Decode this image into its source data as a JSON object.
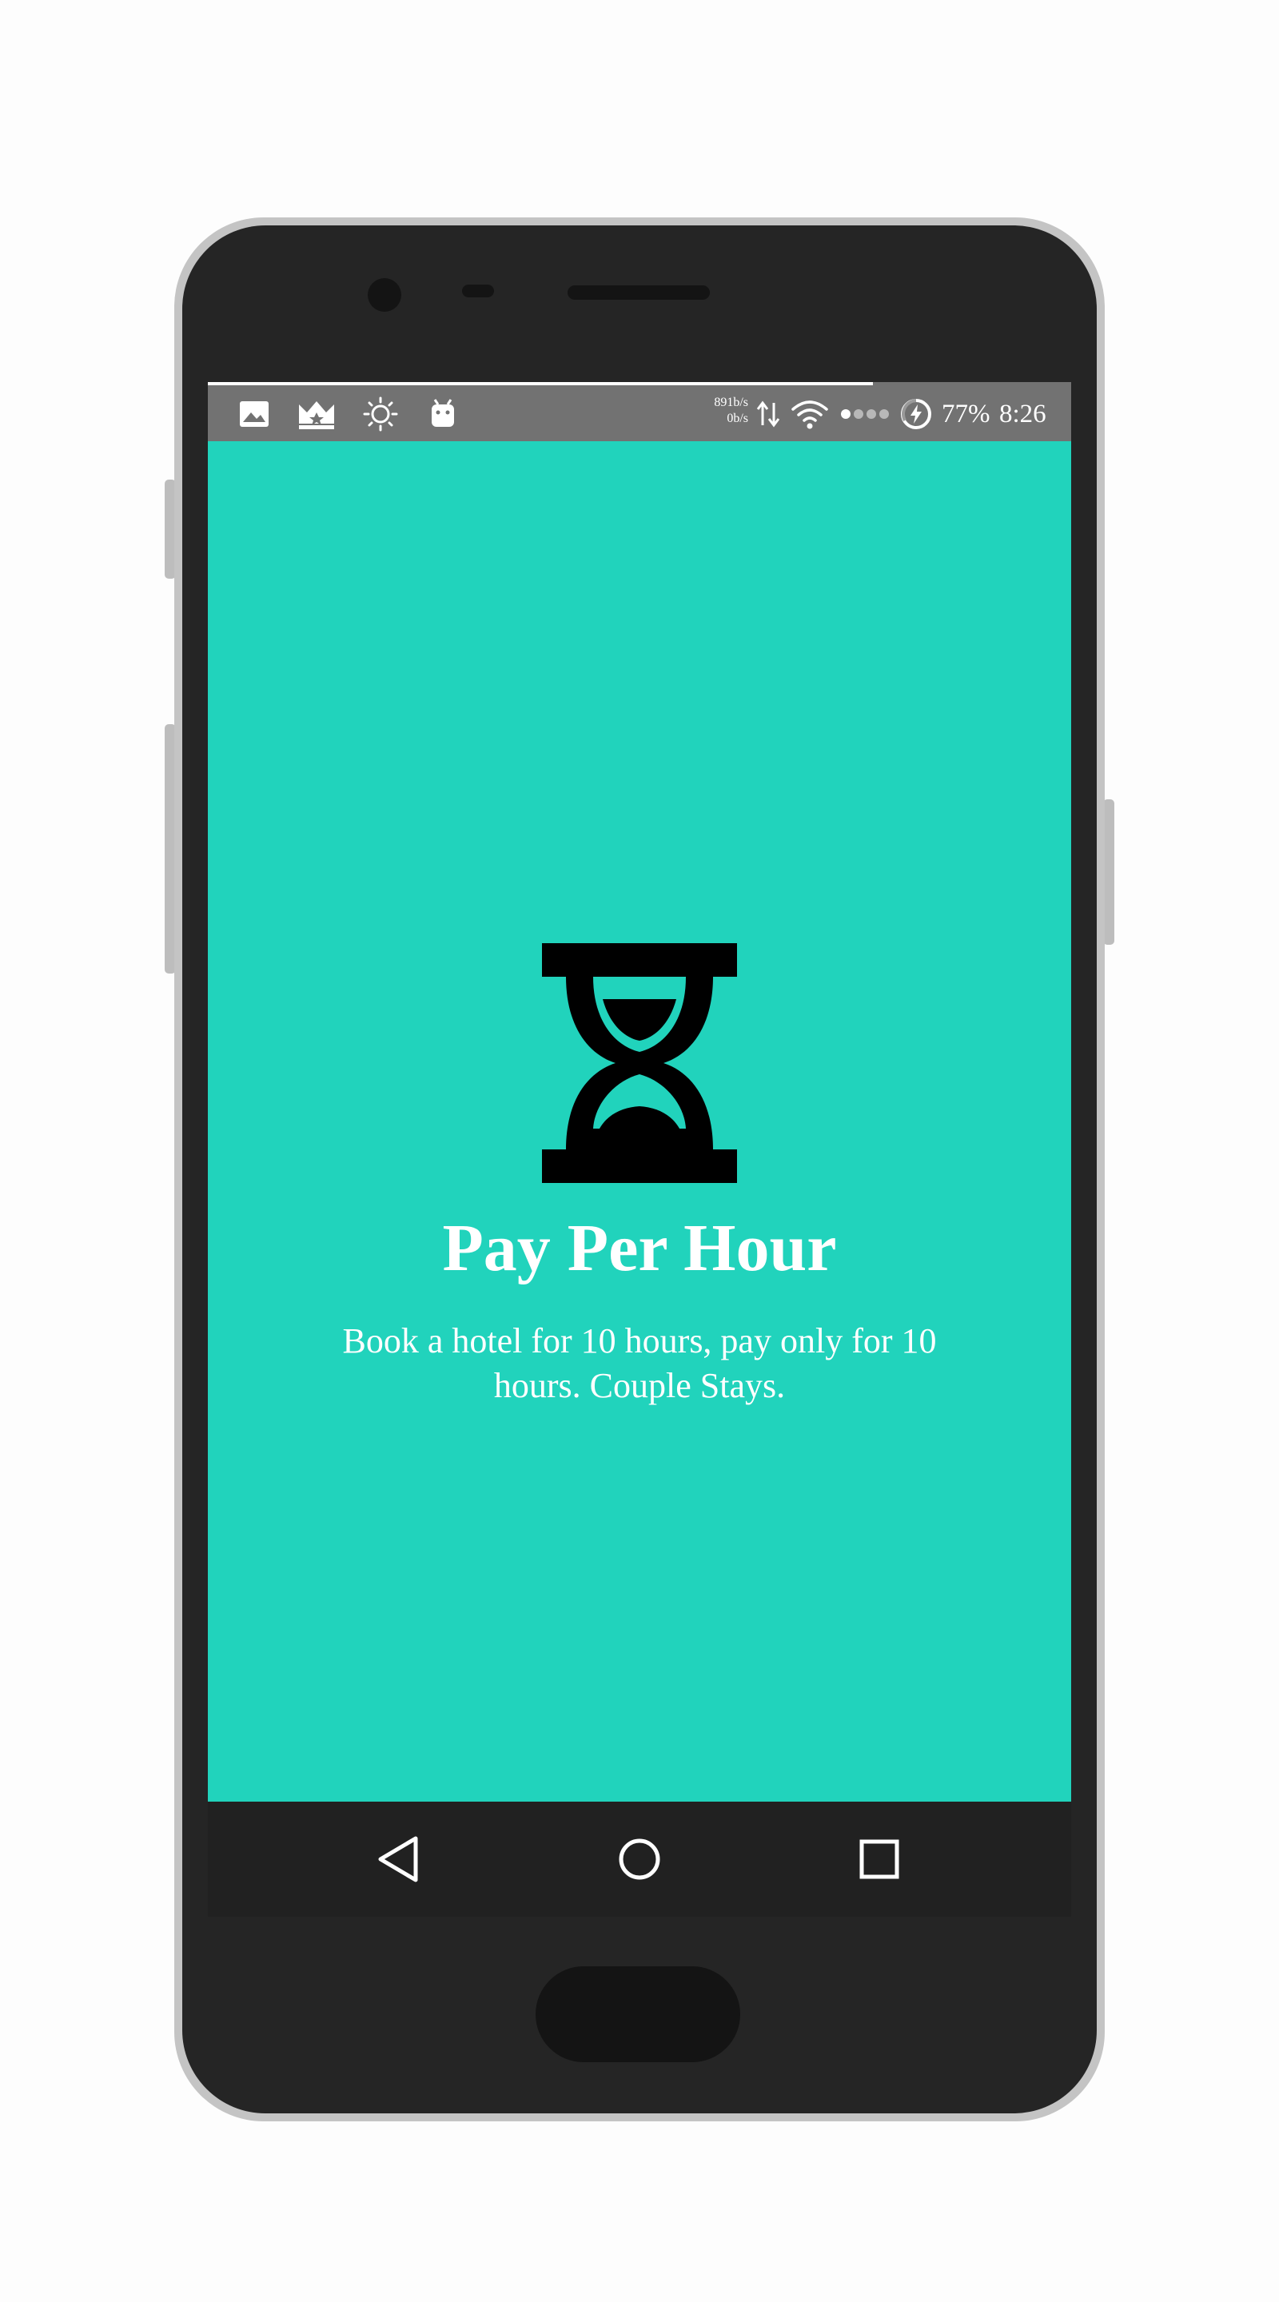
{
  "status_bar": {
    "net_up": "891b/s",
    "net_down": "0b/s",
    "battery": "77%",
    "time": "8:26",
    "icons": [
      "image-icon",
      "crown-icon",
      "brightness-icon",
      "android-icon",
      "data-arrows-icon",
      "wifi-icon",
      "signal-dots-icon",
      "battery-charging-icon"
    ]
  },
  "onboarding": {
    "icon": "hourglass-icon",
    "title": "Pay Per Hour",
    "description": "Book a hotel for 10 hours, pay only for 10 hours. Couple Stays."
  },
  "nav_bar": {
    "buttons": [
      "back-icon",
      "home-icon",
      "recents-icon"
    ]
  },
  "colors": {
    "screen_background": "#21d3bc",
    "status_bar": "#727272",
    "nav_bar": "#212121",
    "text": "#ffffff",
    "icon": "#000000"
  }
}
